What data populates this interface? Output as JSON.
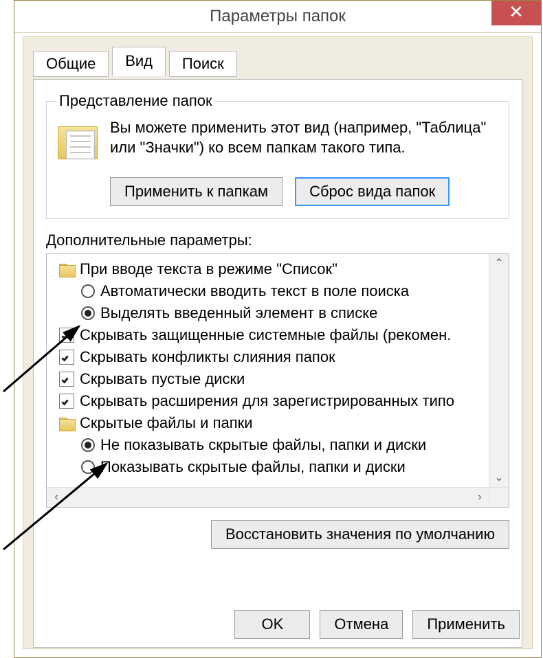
{
  "window": {
    "title": "Параметры папок",
    "close_symbol": "✕"
  },
  "tabs": {
    "general": "Общие",
    "view": "Вид",
    "search": "Поиск"
  },
  "folderViews": {
    "legend": "Представление папок",
    "description": "Вы можете применить этот вид (например, \"Таблица\" или \"Значки\") ко всем папкам такого типа.",
    "apply_btn": "Применить к папкам",
    "reset_btn": "Сброс вида папок"
  },
  "advanced": {
    "label": "Дополнительные параметры:",
    "items": [
      {
        "kind": "folder",
        "text": "При вводе текста в режиме \"Список\""
      },
      {
        "kind": "radio",
        "checked": false,
        "text": "Автоматически вводить текст в поле поиска"
      },
      {
        "kind": "radio",
        "checked": true,
        "text": "Выделять введенный элемент в списке"
      },
      {
        "kind": "check",
        "checked": true,
        "text": "Скрывать защищенные системные файлы (рекомен."
      },
      {
        "kind": "check",
        "checked": true,
        "text": "Скрывать конфликты слияния папок"
      },
      {
        "kind": "check",
        "checked": true,
        "text": "Скрывать пустые диски"
      },
      {
        "kind": "check",
        "checked": true,
        "text": "Скрывать расширения для зарегистрированных типо"
      },
      {
        "kind": "folder",
        "text": "Скрытые файлы и папки"
      },
      {
        "kind": "radio",
        "checked": true,
        "text": "Не показывать скрытые файлы, папки и диски"
      },
      {
        "kind": "radio",
        "checked": false,
        "text": "Показывать скрытые файлы, папки и диски"
      }
    ],
    "restore_btn": "Восстановить значения по умолчанию"
  },
  "footer": {
    "ok": "OK",
    "cancel": "Отмена",
    "apply": "Применить"
  },
  "scroll": {
    "up": "⌃",
    "down": "⌄",
    "left": "‹",
    "right": "›"
  }
}
